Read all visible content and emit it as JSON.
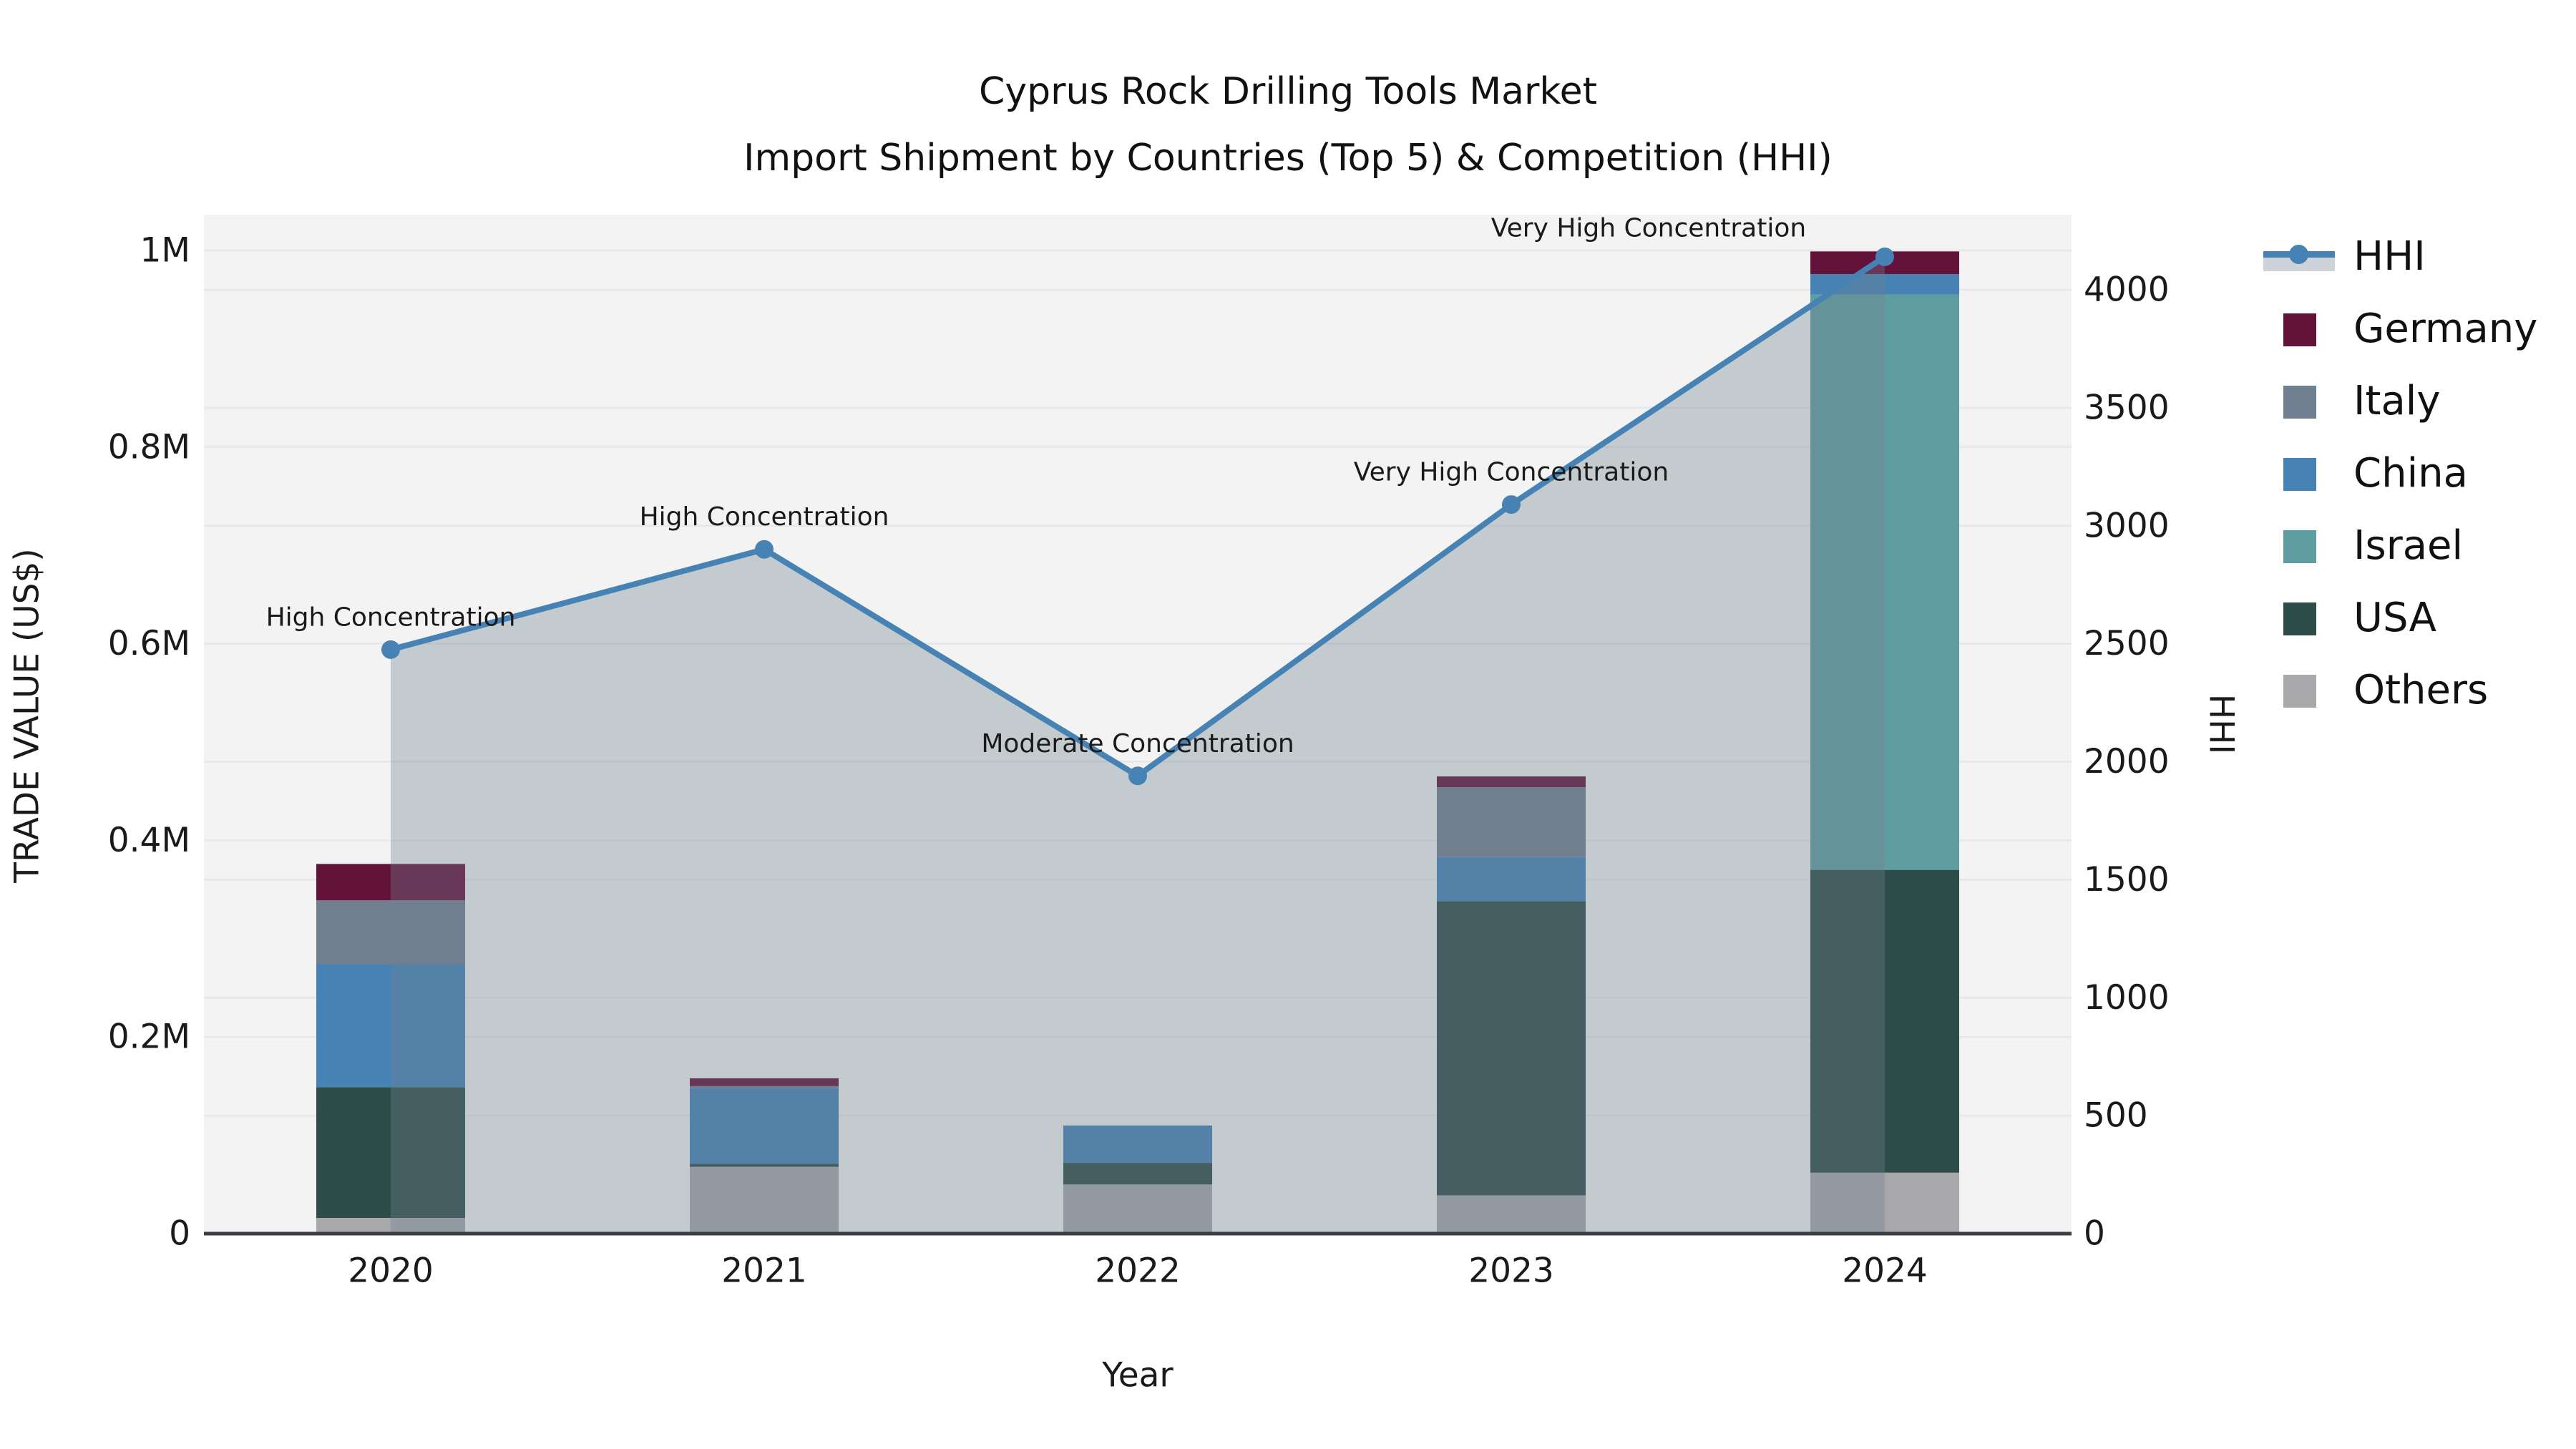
{
  "title": {
    "line1": "Cyprus Rock Drilling Tools Market",
    "line2": "Import Shipment by Countries (Top 5) & Competition (HHI)"
  },
  "axes": {
    "left_title": "TRADE VALUE (US$)",
    "right_title": "HHI",
    "x_title": "Year",
    "left_ticks": [
      {
        "label": "0",
        "value": 0
      },
      {
        "label": "0.2M",
        "value": 0.2
      },
      {
        "label": "0.4M",
        "value": 0.4
      },
      {
        "label": "0.6M",
        "value": 0.6
      },
      {
        "label": "0.8M",
        "value": 0.8
      },
      {
        "label": "1M",
        "value": 1.0
      }
    ],
    "right_ticks": [
      {
        "label": "0",
        "value": 0
      },
      {
        "label": "500",
        "value": 500
      },
      {
        "label": "1000",
        "value": 1000
      },
      {
        "label": "1500",
        "value": 1500
      },
      {
        "label": "2000",
        "value": 2000
      },
      {
        "label": "2500",
        "value": 2500
      },
      {
        "label": "3000",
        "value": 3000
      },
      {
        "label": "3500",
        "value": 3500
      },
      {
        "label": "4000",
        "value": 4000
      }
    ]
  },
  "legend": {
    "items": [
      {
        "key": "hhi",
        "label": "HHI",
        "type": "line"
      },
      {
        "key": "germany",
        "label": "Germany",
        "type": "swatch"
      },
      {
        "key": "italy",
        "label": "Italy",
        "type": "swatch"
      },
      {
        "key": "china",
        "label": "China",
        "type": "swatch"
      },
      {
        "key": "israel",
        "label": "Israel",
        "type": "swatch"
      },
      {
        "key": "usa",
        "label": "USA",
        "type": "swatch"
      },
      {
        "key": "others",
        "label": "Others",
        "type": "swatch"
      }
    ]
  },
  "colors": {
    "germany": "#631239",
    "italy": "#6f7f8f",
    "china": "#4682b4",
    "israel": "#5f9ea0",
    "usa": "#2e4c4a",
    "others": "#a8a8ab",
    "hhi_line": "#4682b4",
    "hhi_fill": "rgba(112,128,144,0.35)",
    "plot_bg": "#f2f3f2",
    "grid": "#e5e7ea",
    "axis_line": "#3a3e42",
    "text": "#1a1a1a"
  },
  "chart_data": {
    "type": "bar+line",
    "title": "Cyprus Rock Drilling Tools Market — Import Shipment by Countries (Top 5) & Competition (HHI)",
    "categories": [
      "2020",
      "2021",
      "2022",
      "2023",
      "2024"
    ],
    "bar_value_unit": "trade value in millions of US$",
    "stack_order_bottom_to_top": [
      "Others",
      "USA",
      "Israel",
      "China",
      "Italy",
      "Germany"
    ],
    "series": [
      {
        "name": "Germany",
        "values": [
          0.037,
          0.008,
          0,
          0.011,
          0.023
        ]
      },
      {
        "name": "Italy",
        "values": [
          0.065,
          0.002,
          0,
          0.071,
          0
        ]
      },
      {
        "name": "China",
        "values": [
          0.125,
          0.077,
          0.038,
          0.045,
          0.021
        ]
      },
      {
        "name": "Israel",
        "values": [
          0,
          0,
          0,
          0,
          0.585
        ]
      },
      {
        "name": "USA",
        "values": [
          0.133,
          0.003,
          0.022,
          0.299,
          0.308
        ]
      },
      {
        "name": "Others",
        "values": [
          0.016,
          0.068,
          0.05,
          0.039,
          0.062
        ]
      }
    ],
    "line_series": {
      "name": "HHI",
      "values": [
        2475,
        2900,
        1940,
        3090,
        4140
      ]
    },
    "annotations": [
      {
        "year": "2020",
        "text": "High Concentration",
        "dx": 0,
        "dy": -45
      },
      {
        "year": "2021",
        "text": "High Concentration",
        "dx": 0,
        "dy": -45
      },
      {
        "year": "2022",
        "text": "Moderate Concentration",
        "dx": 0,
        "dy": -45
      },
      {
        "year": "2023",
        "text": "Very High Concentration",
        "dx": 0,
        "dy": -45
      },
      {
        "year": "2024",
        "text": "Very High Concentration",
        "dx": -330,
        "dy": -40
      }
    ],
    "ylim_left": [
      0,
      1.04
    ],
    "ylim_right": [
      0,
      4330
    ],
    "grid": true,
    "legend_position": "right"
  }
}
